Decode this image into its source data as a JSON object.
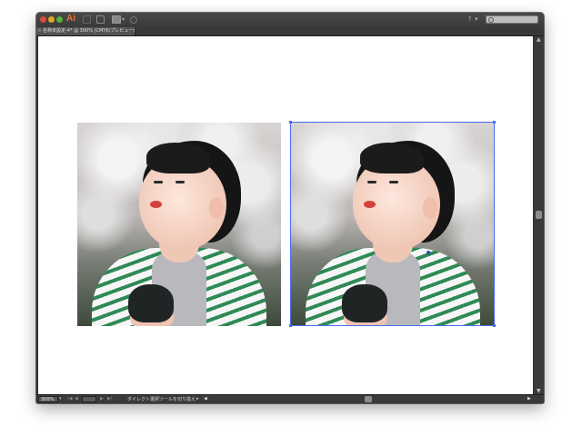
{
  "window": {
    "app_logo": "Ai",
    "document_tab": "名称未設定-4* @ 300% (CMYK/プレビュー)",
    "tab_close_glyph": "×"
  },
  "toolbar": {
    "icons": [
      "bridge-icon",
      "stock-icon",
      "arrange-documents-icon",
      "gpu-icon"
    ]
  },
  "search": {
    "placeholder": ""
  },
  "statusbar": {
    "zoom": "300%",
    "status_text": "ダイレクト選択ツールを切り換え"
  },
  "artwork": {
    "items": [
      "raster-photo",
      "raster-photo-selected"
    ],
    "selection_color": "#4a6bf0"
  }
}
